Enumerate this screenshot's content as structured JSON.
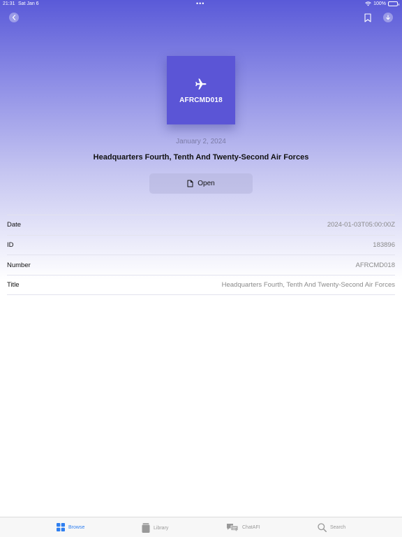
{
  "status_bar": {
    "time": "21:31",
    "date": "Sat Jan 6",
    "battery": "100%",
    "battery_level": 1.0
  },
  "nav": {
    "back_icon": "chevron-left-icon",
    "bookmark_icon": "bookmark-icon",
    "download_icon": "download-icon"
  },
  "document": {
    "cover_label": "AFRCMD018",
    "date": "January 2, 2024",
    "title": "Headquarters Fourth, Tenth And Twenty-Second Air Forces",
    "open_label": "Open"
  },
  "details": [
    {
      "label": "Date",
      "value": "2024-01-03T05:00:00Z"
    },
    {
      "label": "ID",
      "value": "183896"
    },
    {
      "label": "Number",
      "value": "AFRCMD018"
    },
    {
      "label": "Title",
      "value": "Headquarters Fourth, Tenth And Twenty-Second Air Forces"
    }
  ],
  "tabs": [
    {
      "label": "Browse",
      "icon": "grid-icon",
      "active": true
    },
    {
      "label": "Library",
      "icon": "library-icon",
      "active": false
    },
    {
      "label": "ChatAFI",
      "icon": "chat-icon",
      "active": false
    },
    {
      "label": "Search",
      "icon": "search-icon",
      "active": false
    }
  ],
  "colors": {
    "accent": "#2f7ff0",
    "cover": "#5b55d6",
    "header_top": "#5a5ad8"
  }
}
